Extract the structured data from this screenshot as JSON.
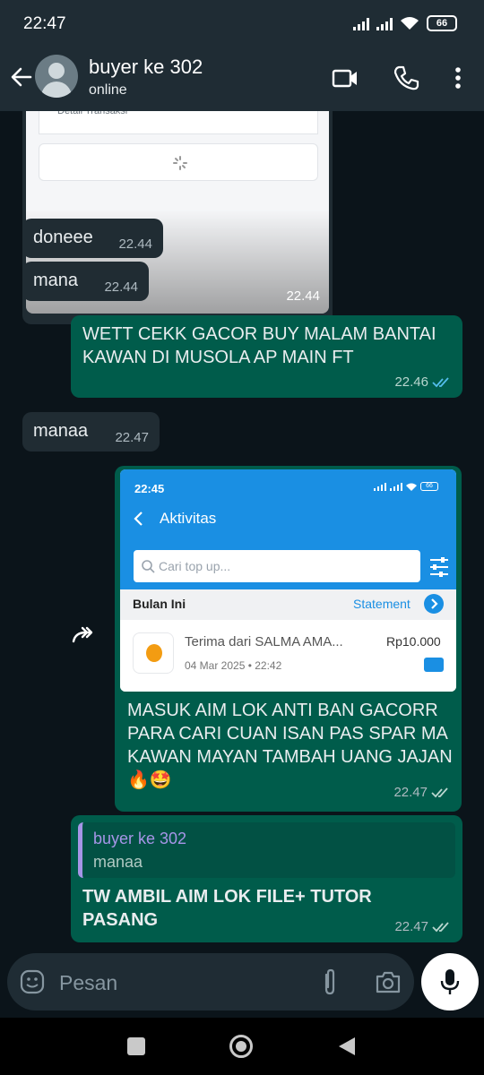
{
  "status_bar": {
    "time": "22:47",
    "battery": "66"
  },
  "header": {
    "contact_name": "buyer ke 302",
    "status": "online"
  },
  "messages": [
    {
      "id": "img1",
      "direction": "incoming",
      "type": "image",
      "ticket_label": "Detail Transaksi",
      "time": "22.44"
    },
    {
      "id": "m1",
      "direction": "incoming",
      "text": "doneee",
      "time": "22.44"
    },
    {
      "id": "m2",
      "direction": "incoming",
      "text": "mana",
      "time": "22.44"
    },
    {
      "id": "m3",
      "direction": "outgoing",
      "text": "WETT CEKK GACOR BUY MALAM BANTAI KAWAN DI MUSOLA AP MAIN FT",
      "time": "22.46",
      "status": "read"
    },
    {
      "id": "m4",
      "direction": "incoming",
      "text": "manaa",
      "time": "22.47"
    },
    {
      "id": "m5",
      "direction": "outgoing",
      "type": "image",
      "forwarded": true,
      "screenshot": {
        "time": "22:45",
        "battery": "66",
        "title": "Aktivitas",
        "search_placeholder": "Cari top up...",
        "section": "Bulan Ini",
        "statement_label": "Statement",
        "row_title": "Terima dari SALMA AMA...",
        "row_date": "04 Mar 2025 • 22:42",
        "row_amount": "Rp10.000"
      },
      "caption": "MASUK AIM LOK ANTI BAN GACORR PARA CARI CUAN ISAN PAS SPAR MA KAWAN MAYAN TAMBAH UANG JAJAN 🔥🤩",
      "time": "22.47",
      "status": "delivered"
    },
    {
      "id": "m6",
      "direction": "outgoing",
      "quote": {
        "name": "buyer ke 302",
        "text": "manaa"
      },
      "text": "TW AMBIL AIM LOK FILE+ TUTOR PASANG",
      "time": "22.47",
      "status": "delivered"
    }
  ],
  "composer": {
    "placeholder": "Pesan"
  },
  "icons": {
    "back": "arrow-left-icon",
    "video": "video-call-icon",
    "call": "phone-icon",
    "menu": "more-vert-icon",
    "emoji": "emoji-icon",
    "attach": "paperclip-icon",
    "camera": "camera-icon",
    "mic": "mic-icon",
    "forward": "forward-icon"
  },
  "colors": {
    "background": "#0b141a",
    "header": "#1f2c34",
    "incoming": "#202c33",
    "outgoing": "#005c4b",
    "read_tick": "#53bdeb",
    "quote_name": "#a695e7"
  }
}
